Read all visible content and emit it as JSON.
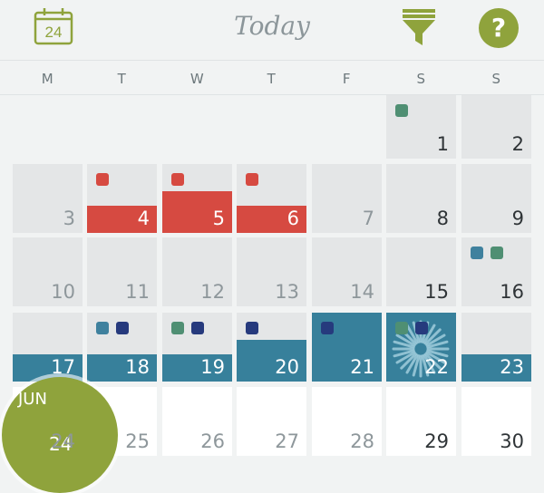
{
  "header": {
    "calendar_icon_day": "24",
    "title": "Today",
    "filter_icon": "filter-icon",
    "help_label": "?"
  },
  "weekdays": [
    "M",
    "T",
    "W",
    "T",
    "F",
    "S",
    "S"
  ],
  "weeks": [
    {
      "days": [
        null,
        null,
        null,
        null,
        null,
        {
          "label": "1",
          "dots": [
            "green"
          ]
        },
        {
          "label": "2",
          "dots": []
        }
      ]
    },
    {
      "days": [
        {
          "label": "3",
          "dots": [],
          "muted": true
        },
        {
          "label": "4",
          "dots": [
            "red"
          ],
          "band": "red",
          "fill": 0.4
        },
        {
          "label": "5",
          "dots": [
            "red"
          ],
          "band": "red",
          "fill": 0.6
        },
        {
          "label": "6",
          "dots": [
            "red"
          ],
          "band": "red",
          "fill": 0.4
        },
        {
          "label": "7",
          "dots": [],
          "muted": true
        },
        {
          "label": "8",
          "dots": []
        },
        {
          "label": "9",
          "dots": []
        }
      ]
    },
    {
      "days": [
        {
          "label": "10",
          "dots": [],
          "muted": true
        },
        {
          "label": "11",
          "dots": [],
          "muted": true
        },
        {
          "label": "12",
          "dots": [],
          "muted": true
        },
        {
          "label": "13",
          "dots": [],
          "muted": true
        },
        {
          "label": "14",
          "dots": [],
          "muted": true
        },
        {
          "label": "15",
          "dots": []
        },
        {
          "label": "16",
          "dots": [
            "teal",
            "green"
          ]
        }
      ]
    },
    {
      "days": [
        {
          "label": "17",
          "dots": [],
          "band": "teal",
          "fill": 0.4
        },
        {
          "label": "18",
          "dots": [
            "teal",
            "navy"
          ],
          "band": "teal",
          "fill": 0.4
        },
        {
          "label": "19",
          "dots": [
            "green",
            "navy"
          ],
          "band": "teal",
          "fill": 0.4
        },
        {
          "label": "20",
          "dots": [
            "navy"
          ],
          "band": "teal",
          "fill": 0.6
        },
        {
          "label": "21",
          "dots": [
            "navy"
          ],
          "band": "teal",
          "fill": 1.0
        },
        {
          "label": "22",
          "dots": [
            "green",
            "navy"
          ],
          "band": "teal",
          "fill": 1.0,
          "today": true
        },
        {
          "label": "23",
          "dots": [],
          "band": "teal",
          "fill": 0.4
        }
      ]
    },
    {
      "days": [
        {
          "label": "24",
          "dots": [],
          "future": true,
          "muted": true
        },
        {
          "label": "25",
          "dots": [],
          "future": true,
          "muted": true
        },
        {
          "label": "26",
          "dots": [],
          "future": true,
          "muted": true
        },
        {
          "label": "27",
          "dots": [],
          "future": true,
          "muted": true
        },
        {
          "label": "28",
          "dots": [],
          "future": true,
          "muted": true
        },
        {
          "label": "29",
          "dots": [],
          "future": true
        },
        {
          "label": "30",
          "dots": [],
          "future": true
        }
      ]
    }
  ],
  "month_bubble": {
    "month": "JUN",
    "day": "24"
  },
  "colors": {
    "accent_green": "#8fa33c",
    "event_red": "#d64a41",
    "event_teal": "#37809b",
    "dot_green": "#4f8f73",
    "dot_navy": "#263a7d"
  }
}
